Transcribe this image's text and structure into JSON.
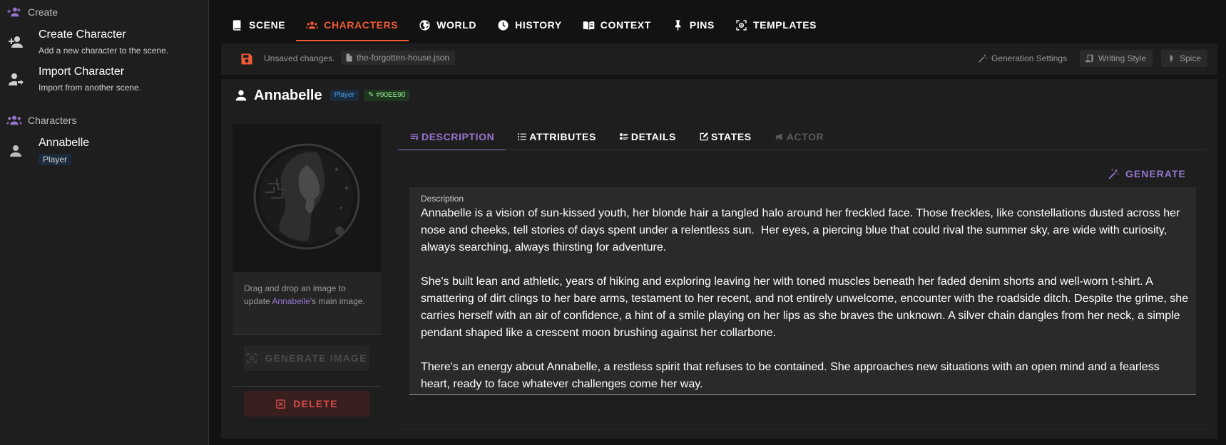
{
  "sidebar": {
    "create_header": "Create",
    "create_items": [
      {
        "title": "Create Character",
        "subtitle": "Add a new character to the scene."
      },
      {
        "title": "Import Character",
        "subtitle": "Import from another scene."
      }
    ],
    "characters_header": "Characters",
    "characters": [
      {
        "name": "Annabelle",
        "role": "Player"
      }
    ]
  },
  "topnav": {
    "tabs": [
      "SCENE",
      "CHARACTERS",
      "WORLD",
      "HISTORY",
      "CONTEXT",
      "PINS",
      "TEMPLATES"
    ],
    "active": "CHARACTERS"
  },
  "toolbar": {
    "status": "Unsaved changes.",
    "filename": "the-forgotten-house.json",
    "generation_settings": "Generation Settings",
    "writing_style": "Writing Style",
    "spice": "Spice"
  },
  "character": {
    "name": "Annabelle",
    "role_badge": "Player",
    "color_badge": "#90EE90",
    "drop_text_pre": "Drag and drop an image to update ",
    "drop_text_name": "Annabelle",
    "drop_text_post": "'s main image.",
    "generate_image_label": "GENERATE IMAGE",
    "delete_label": "DELETE"
  },
  "subtabs": {
    "tabs": [
      "DESCRIPTION",
      "ATTRIBUTES",
      "DETAILS",
      "STATES",
      "ACTOR"
    ],
    "active": "DESCRIPTION",
    "disabled": "ACTOR"
  },
  "description": {
    "generate_label": "GENERATE",
    "field_label": "Description",
    "text": "Annabelle is a vision of sun-kissed youth, her blonde hair a tangled halo around her freckled face. Those freckles, like constellations dusted across her nose and cheeks, tell stories of days spent under a relentless sun.  Her eyes, a piercing blue that could rival the summer sky, are wide with curiosity, always searching, always thirsting for adventure.\n\nShe's built lean and athletic, years of hiking and exploring leaving her with toned muscles beneath her faded denim shorts and well-worn t-shirt. A smattering of dirt clings to her bare arms, testament to her recent, and not entirely unwelcome, encounter with the roadside ditch. Despite the grime, she carries herself with an air of confidence, a hint of a smile playing on her lips as she braves the unknown. A silver chain dangles from her neck, a simple pendant shaped like a crescent moon brushing against her collarbone.\n\nThere's an energy about Annabelle, a restless spirit that refuses to be contained. She approaches new situations with an open mind and a fearless heart, ready to face whatever challenges come her way."
  },
  "colors": {
    "accent_orange": "#ef5b37",
    "accent_purple": "#9575cd",
    "player_blue": "#42a5f5",
    "char_green": "#90ee90",
    "danger_red": "#d94b4b"
  }
}
